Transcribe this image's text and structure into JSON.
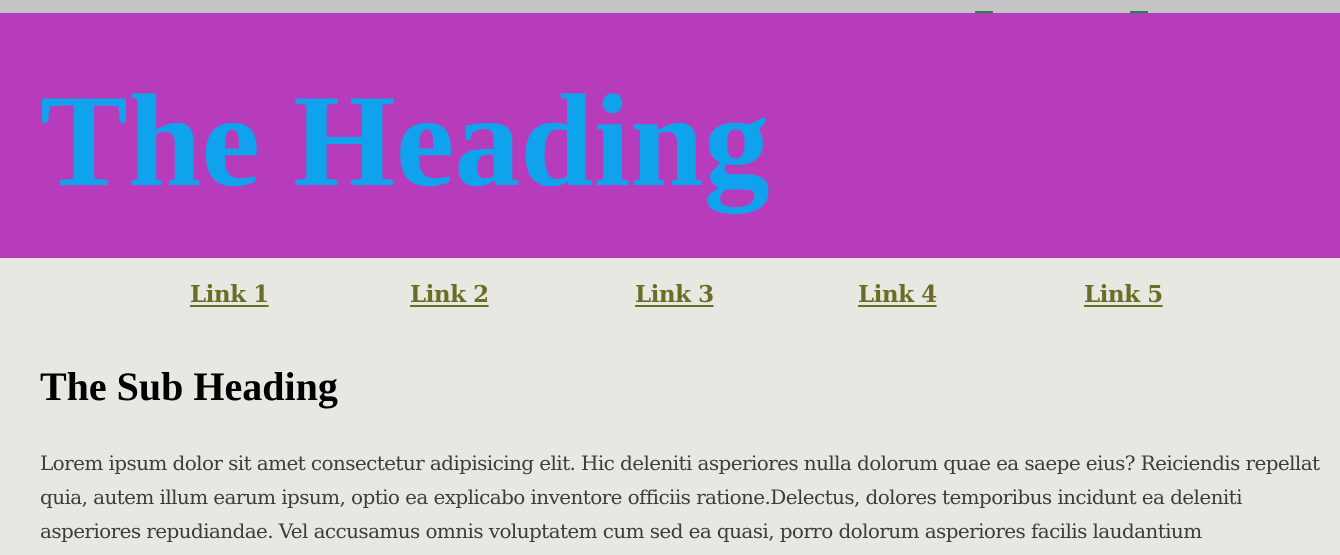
{
  "header": {
    "heading": "The Heading",
    "heading_color": "#0fa3ee",
    "background_color": "#b73cbb"
  },
  "nav": {
    "links": [
      {
        "label": "Link 1"
      },
      {
        "label": "Link 2"
      },
      {
        "label": "Link 3"
      },
      {
        "label": "Link 4"
      },
      {
        "label": "Link 5"
      }
    ],
    "link_color": "#6b6d24"
  },
  "main": {
    "sub_heading": "The Sub Heading",
    "paragraph": "Lorem ipsum dolor sit amet consectetur adipisicing elit. Hic deleniti asperiores nulla dolorum quae ea saepe eius? Reiciendis repellat quia, autem illum earum ipsum, optio ea explicabo inventore officiis ratione.Delectus, dolores temporibus incidunt ea deleniti asperiores repudiandae. Vel accusamus omnis voluptatem cum sed ea quasi, porro dolorum asperiores facilis laudantium"
  },
  "page": {
    "background_color": "#e7e8e2"
  }
}
